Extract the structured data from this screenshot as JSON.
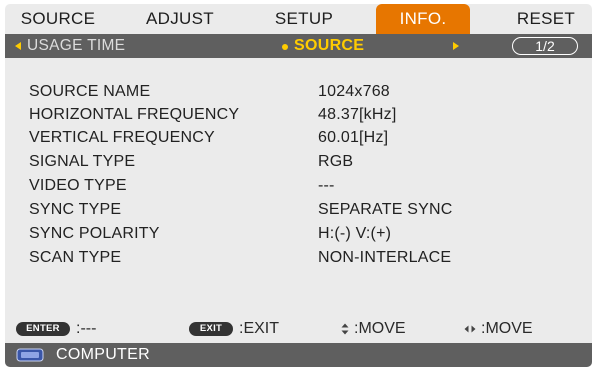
{
  "tabs": [
    {
      "label": "SOURCE"
    },
    {
      "label": "ADJUST"
    },
    {
      "label": "SETUP"
    },
    {
      "label": "INFO."
    },
    {
      "label": "RESET"
    }
  ],
  "active_tab": "INFO.",
  "subbar": {
    "left_label": "USAGE TIME",
    "center_label": "SOURCE",
    "page_indicator": "1/2"
  },
  "info_rows": [
    {
      "label": "SOURCE NAME",
      "value": "1024x768"
    },
    {
      "label": "HORIZONTAL FREQUENCY",
      "value": "48.37[kHz]"
    },
    {
      "label": "VERTICAL FREQUENCY",
      "value": "60.01[Hz]"
    },
    {
      "label": "SIGNAL TYPE",
      "value": "RGB"
    },
    {
      "label": "VIDEO TYPE",
      "value": "---"
    },
    {
      "label": "SYNC TYPE",
      "value": "SEPARATE SYNC"
    },
    {
      "label": "SYNC POLARITY",
      "value": "H:(-) V:(+)"
    },
    {
      "label": "SCAN TYPE",
      "value": "NON-INTERLACE"
    }
  ],
  "footer": {
    "enter_key": "ENTER",
    "enter_text": ":---",
    "exit_key": "EXIT",
    "exit_text": ":EXIT",
    "updown_text": ":MOVE",
    "leftright_text": ":MOVE"
  },
  "source_bar": {
    "icon": "computer-icon",
    "label": "COMPUTER"
  },
  "colors": {
    "menu_bg": "#ebebeb",
    "active_tab": "#e77600",
    "bar_bg": "#5f5f5f",
    "highlight": "#ffcc00",
    "text": "#222222"
  }
}
